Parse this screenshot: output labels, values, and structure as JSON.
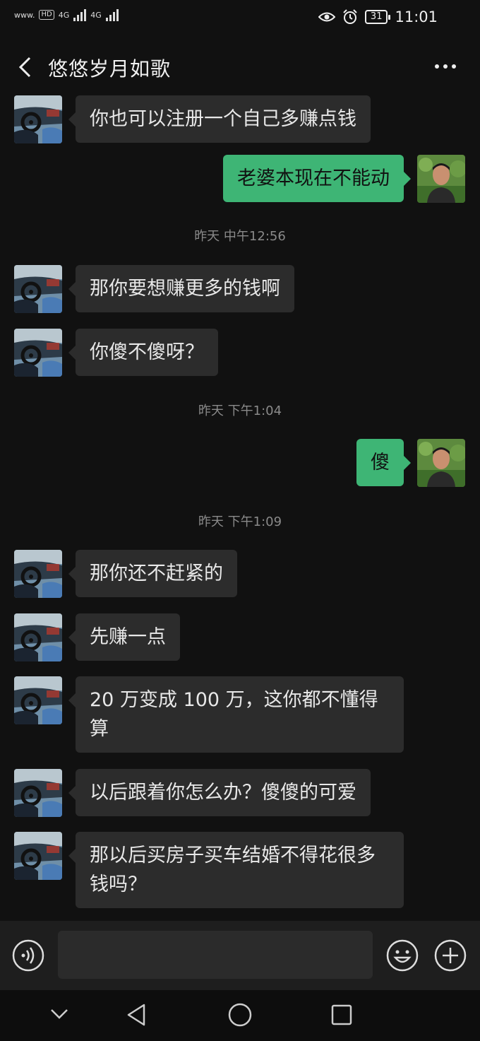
{
  "status_bar": {
    "left_text": "www.",
    "hd_label": "HD",
    "network_1": "4G",
    "network_2": "4G",
    "battery": "31",
    "time": "11:01"
  },
  "header": {
    "title": "悠悠岁月如歌"
  },
  "messages": [
    {
      "type": "in",
      "text": "你也可以注册一个自己多赚点钱"
    },
    {
      "type": "out",
      "text": "老婆本现在不能动"
    },
    {
      "type": "time",
      "text": "昨天 中午12:56"
    },
    {
      "type": "in",
      "text": "那你要想赚更多的钱啊"
    },
    {
      "type": "in",
      "text": "你傻不傻呀？"
    },
    {
      "type": "time",
      "text": "昨天 下午1:04"
    },
    {
      "type": "out",
      "text": "傻"
    },
    {
      "type": "time",
      "text": "昨天 下午1:09"
    },
    {
      "type": "in",
      "text": "那你还不赶紧的"
    },
    {
      "type": "in",
      "text": "先赚一点"
    },
    {
      "type": "in",
      "text": "20 万变成 100 万，这你都不懂得算"
    },
    {
      "type": "in",
      "text": "以后跟着你怎么办？傻傻的可爱"
    },
    {
      "type": "in",
      "text": "那以后买房子买车结婚不得花很多钱吗？"
    }
  ],
  "input_bar": {
    "value": "",
    "placeholder": ""
  },
  "icons": {
    "back": "back-icon",
    "more": "more-icon",
    "voice": "voice-icon",
    "emoji": "emoji-icon",
    "plus": "plus-icon",
    "nav_down": "chevron-down-icon",
    "nav_back": "nav-back-icon",
    "nav_home": "nav-home-icon",
    "nav_recent": "nav-recents-icon"
  },
  "colors": {
    "background": "#111111",
    "incoming_bubble": "#2c2c2c",
    "outgoing_bubble": "#3eb575",
    "timestamp": "#8a8a8a"
  }
}
